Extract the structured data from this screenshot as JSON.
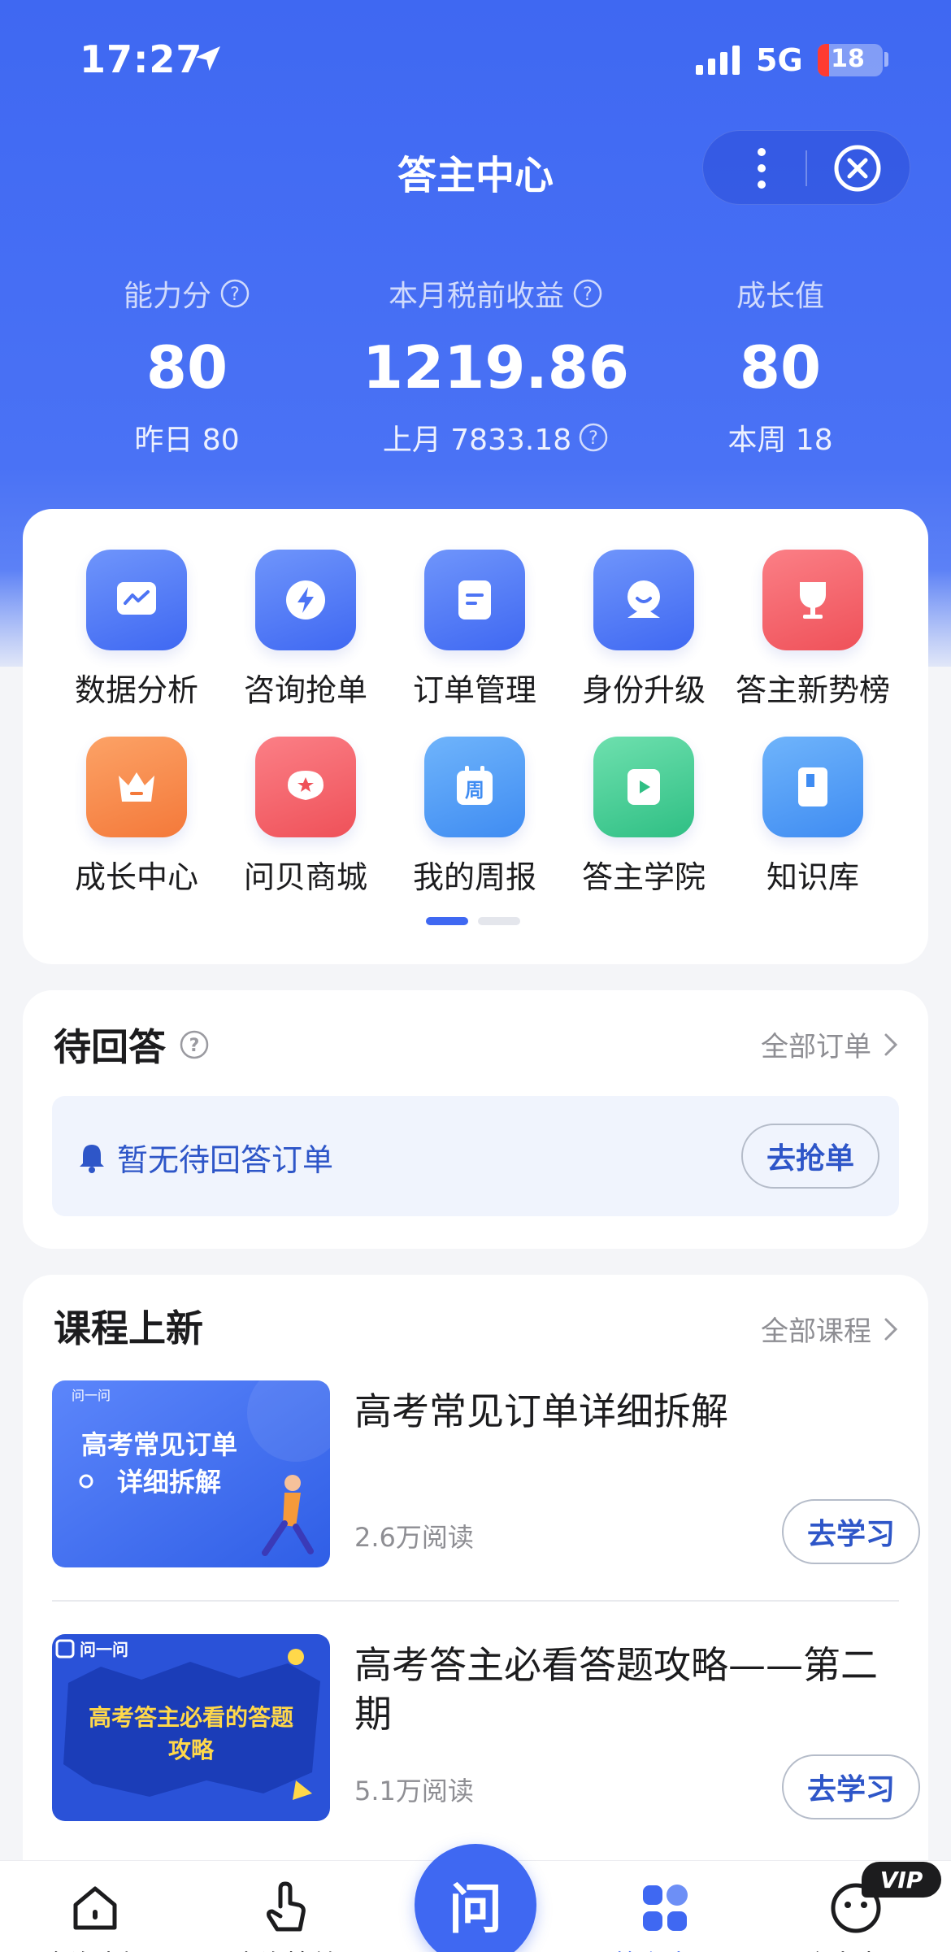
{
  "status_bar": {
    "time": "17:27",
    "network": "5G",
    "battery": "18",
    "battery_level": 0.18
  },
  "header": {
    "title": "答主中心"
  },
  "stats": [
    {
      "label": "能力分",
      "value": "80",
      "sub": "昨日 80"
    },
    {
      "label": "本月税前收益",
      "value": "1219.86",
      "sub": "上月 7833.18"
    },
    {
      "label": "成长值",
      "value": "80",
      "sub": "本周 18"
    }
  ],
  "menu": {
    "items": [
      {
        "label": "数据分析",
        "icon": "chart-icon"
      },
      {
        "label": "咨询抢单",
        "icon": "lightning-icon"
      },
      {
        "label": "订单管理",
        "icon": "document-icon"
      },
      {
        "label": "身份升级",
        "icon": "user-badge-icon"
      },
      {
        "label": "答主新势榜",
        "icon": "trophy-icon"
      },
      {
        "label": "成长中心",
        "icon": "crown-icon"
      },
      {
        "label": "问贝商城",
        "icon": "shop-icon"
      },
      {
        "label": "我的周报",
        "icon": "calendar-icon",
        "badge_text": "周"
      },
      {
        "label": "答主学院",
        "icon": "play-icon"
      },
      {
        "label": "知识库",
        "icon": "book-icon"
      }
    ],
    "pages": 2,
    "current_page": 1
  },
  "pending": {
    "title": "待回答",
    "link": "全部订单",
    "empty_message": "暂无待回答订单",
    "button": "去抢单"
  },
  "courses": {
    "title": "课程上新",
    "link": "全部课程",
    "items": [
      {
        "title": "高考常见订单详细拆解",
        "reads": "2.6万阅读",
        "button": "去学习",
        "thumb_brand": "问一问",
        "thumb_line1": "高考常见订单",
        "thumb_line2": "详细拆解"
      },
      {
        "title": "高考答主必看答题攻略——第二期",
        "reads": "5.1万阅读",
        "button": "去学习",
        "thumb_brand": "问一问",
        "thumb_line1": "高考答主必看的答题",
        "thumb_line2": "攻略"
      }
    ]
  },
  "tabbar": {
    "items": [
      {
        "label": "咨询广场",
        "icon": "home-icon"
      },
      {
        "label": "咨询抢单",
        "icon": "tap-icon"
      },
      {
        "label": "答主中心",
        "icon": "grid-icon",
        "active": true
      },
      {
        "label": "个人中心",
        "icon": "face-icon"
      }
    ],
    "center_label": "问",
    "vip_badge": "VIP"
  },
  "colors": {
    "primary": "#3f68f2",
    "background": "#f4f5f8",
    "link": "#2e56c8"
  }
}
